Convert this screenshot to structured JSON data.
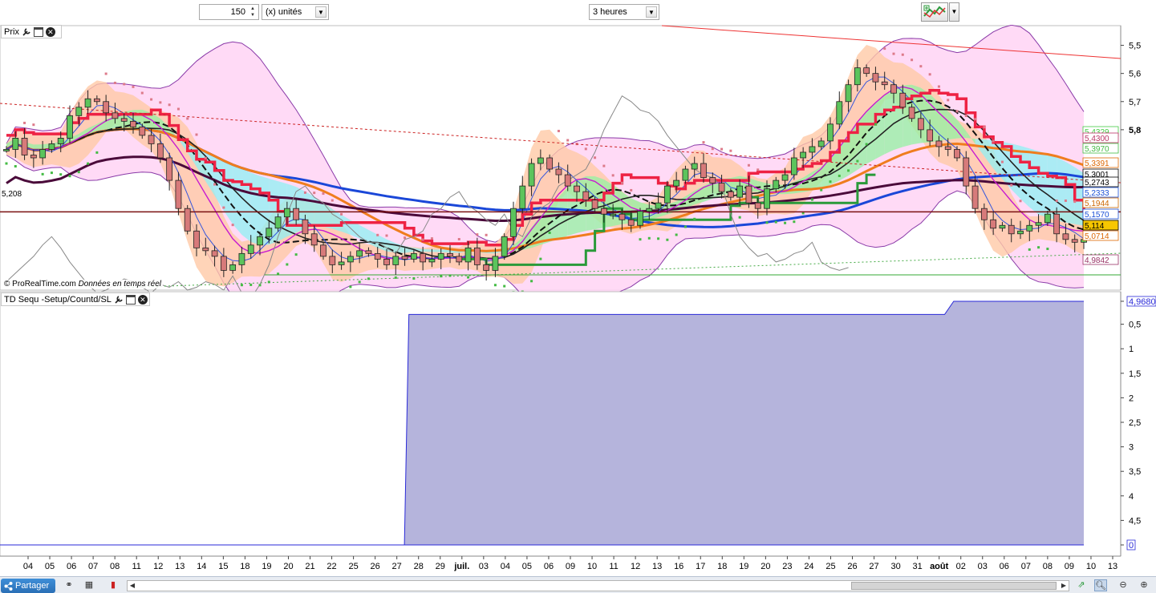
{
  "toolbar": {
    "quantity": "150",
    "units": "(x) unités",
    "period": "3 heures"
  },
  "price_panel": {
    "title": "Prix",
    "copyright": "© ProRealTime.com",
    "realtime": "Données en temps réel",
    "left_label": "5,208",
    "axis_labels": [
      "5,8",
      "5,7",
      "5,6",
      "5,5",
      "4,9842"
    ],
    "price_tags": [
      {
        "text": "5,4329",
        "color": "#44cc44"
      },
      {
        "text": "5,4300",
        "color": "#bb3366"
      },
      {
        "text": "5,3970",
        "color": "#44bb44"
      },
      {
        "text": "5,3391",
        "color": "#dd6600"
      },
      {
        "text": "5,3001",
        "color": "#000000"
      },
      {
        "text": "5,2743",
        "color": "#000000"
      },
      {
        "text": "5,2333",
        "color": "#1a4fd6"
      },
      {
        "text": "5,1944",
        "color": "#cc6600"
      },
      {
        "text": "5,1570",
        "color": "#1a4fd6"
      },
      {
        "text": "5,114",
        "color": "#000000"
      },
      {
        "text": "5,0714",
        "color": "#dd6600"
      },
      {
        "text": "4,9842",
        "color": "#993366"
      }
    ]
  },
  "indicator_panel": {
    "title": "TD Sequ -Setup/Countd/SL",
    "axis_labels": [
      "4,9680",
      "4,5",
      "4",
      "3,5",
      "3",
      "2,5",
      "2",
      "1,5",
      "1",
      "0,5",
      "0"
    ]
  },
  "x_axis_labels": [
    "04",
    "05",
    "06",
    "07",
    "08",
    "11",
    "12",
    "13",
    "14",
    "15",
    "18",
    "19",
    "20",
    "21",
    "22",
    "25",
    "26",
    "27",
    "28",
    "29",
    "juil.",
    "03",
    "04",
    "05",
    "06",
    "09",
    "10",
    "11",
    "12",
    "13",
    "16",
    "17",
    "18",
    "19",
    "20",
    "23",
    "24",
    "25",
    "26",
    "27",
    "30",
    "31",
    "août",
    "02",
    "03",
    "06",
    "07",
    "08",
    "09",
    "10",
    "13"
  ],
  "bottom": {
    "share_label": "Partager"
  },
  "colors": {
    "bull_candle": "#5cc45c",
    "bear_candle": "#d77a7a",
    "bollinger_fill": "#ffd3f5",
    "envelope_fill": "#ffc9a6",
    "ichimoku_cloud_bull": "#93f2a2",
    "ichimoku_cloud_bear": "#8ff0f3",
    "ma_blue": "#1a47d8",
    "ma_orange": "#ef7d1e",
    "ma_darkpurple": "#4a0a3a",
    "kijun_red": "#ee2244",
    "trail_green": "#2a9a3a",
    "indicator_fill": "#b5b4dc",
    "indicator_line": "#2a2ad8"
  },
  "chart_data": [
    {
      "type": "candlestick",
      "title": "",
      "ylim": [
        4.93,
        5.85
      ],
      "y_ticks": [
        5.5,
        5.6,
        5.7,
        5.8
      ],
      "reference_line": 5.208,
      "last_price": 5.114,
      "grid": false,
      "price_series": {
        "close": [
          5.43,
          5.47,
          5.41,
          5.4,
          5.43,
          5.45,
          5.47,
          5.55,
          5.58,
          5.61,
          5.6,
          5.56,
          5.54,
          5.53,
          5.51,
          5.48,
          5.45,
          5.4,
          5.32,
          5.22,
          5.14,
          5.08,
          5.07,
          5.05,
          5.0,
          5.02,
          5.06,
          5.09,
          5.12,
          5.15,
          5.19,
          5.22,
          5.18,
          5.13,
          5.09,
          5.05,
          5.02,
          5.03,
          5.05,
          5.07,
          5.06,
          5.04,
          5.02,
          5.05,
          5.04,
          5.06,
          5.03,
          5.04,
          5.06,
          5.05,
          5.03,
          5.08,
          5.02,
          5.0,
          5.05,
          5.12,
          5.22,
          5.3,
          5.38,
          5.4,
          5.36,
          5.34,
          5.3,
          5.28,
          5.25,
          5.22,
          5.2,
          5.2,
          5.18,
          5.16,
          5.21,
          5.22,
          5.24,
          5.3,
          5.32,
          5.36,
          5.38,
          5.33,
          5.31,
          5.28,
          5.26,
          5.3,
          5.24,
          5.22,
          5.29,
          5.32,
          5.34,
          5.4,
          5.42,
          5.44,
          5.46,
          5.52,
          5.6,
          5.66,
          5.72,
          5.7,
          5.67,
          5.66,
          5.63,
          5.58,
          5.54,
          5.5,
          5.46,
          5.44,
          5.43,
          5.4,
          5.3,
          5.22,
          5.18,
          5.15,
          5.16,
          5.13,
          5.14,
          5.16,
          5.17,
          5.2,
          5.13,
          5.11,
          5.1,
          5.11
        ]
      }
    },
    {
      "type": "area",
      "title": "",
      "ylim": [
        0,
        5
      ],
      "y_ticks": [
        0,
        0.5,
        1,
        1.5,
        2,
        2.5,
        3,
        3.5,
        4,
        4.5,
        4.968
      ],
      "x": [
        0,
        26.3,
        26.6,
        62.0,
        62.6,
        71.2
      ],
      "values": [
        0,
        0,
        4.7,
        4.7,
        4.968,
        4.968
      ]
    }
  ]
}
